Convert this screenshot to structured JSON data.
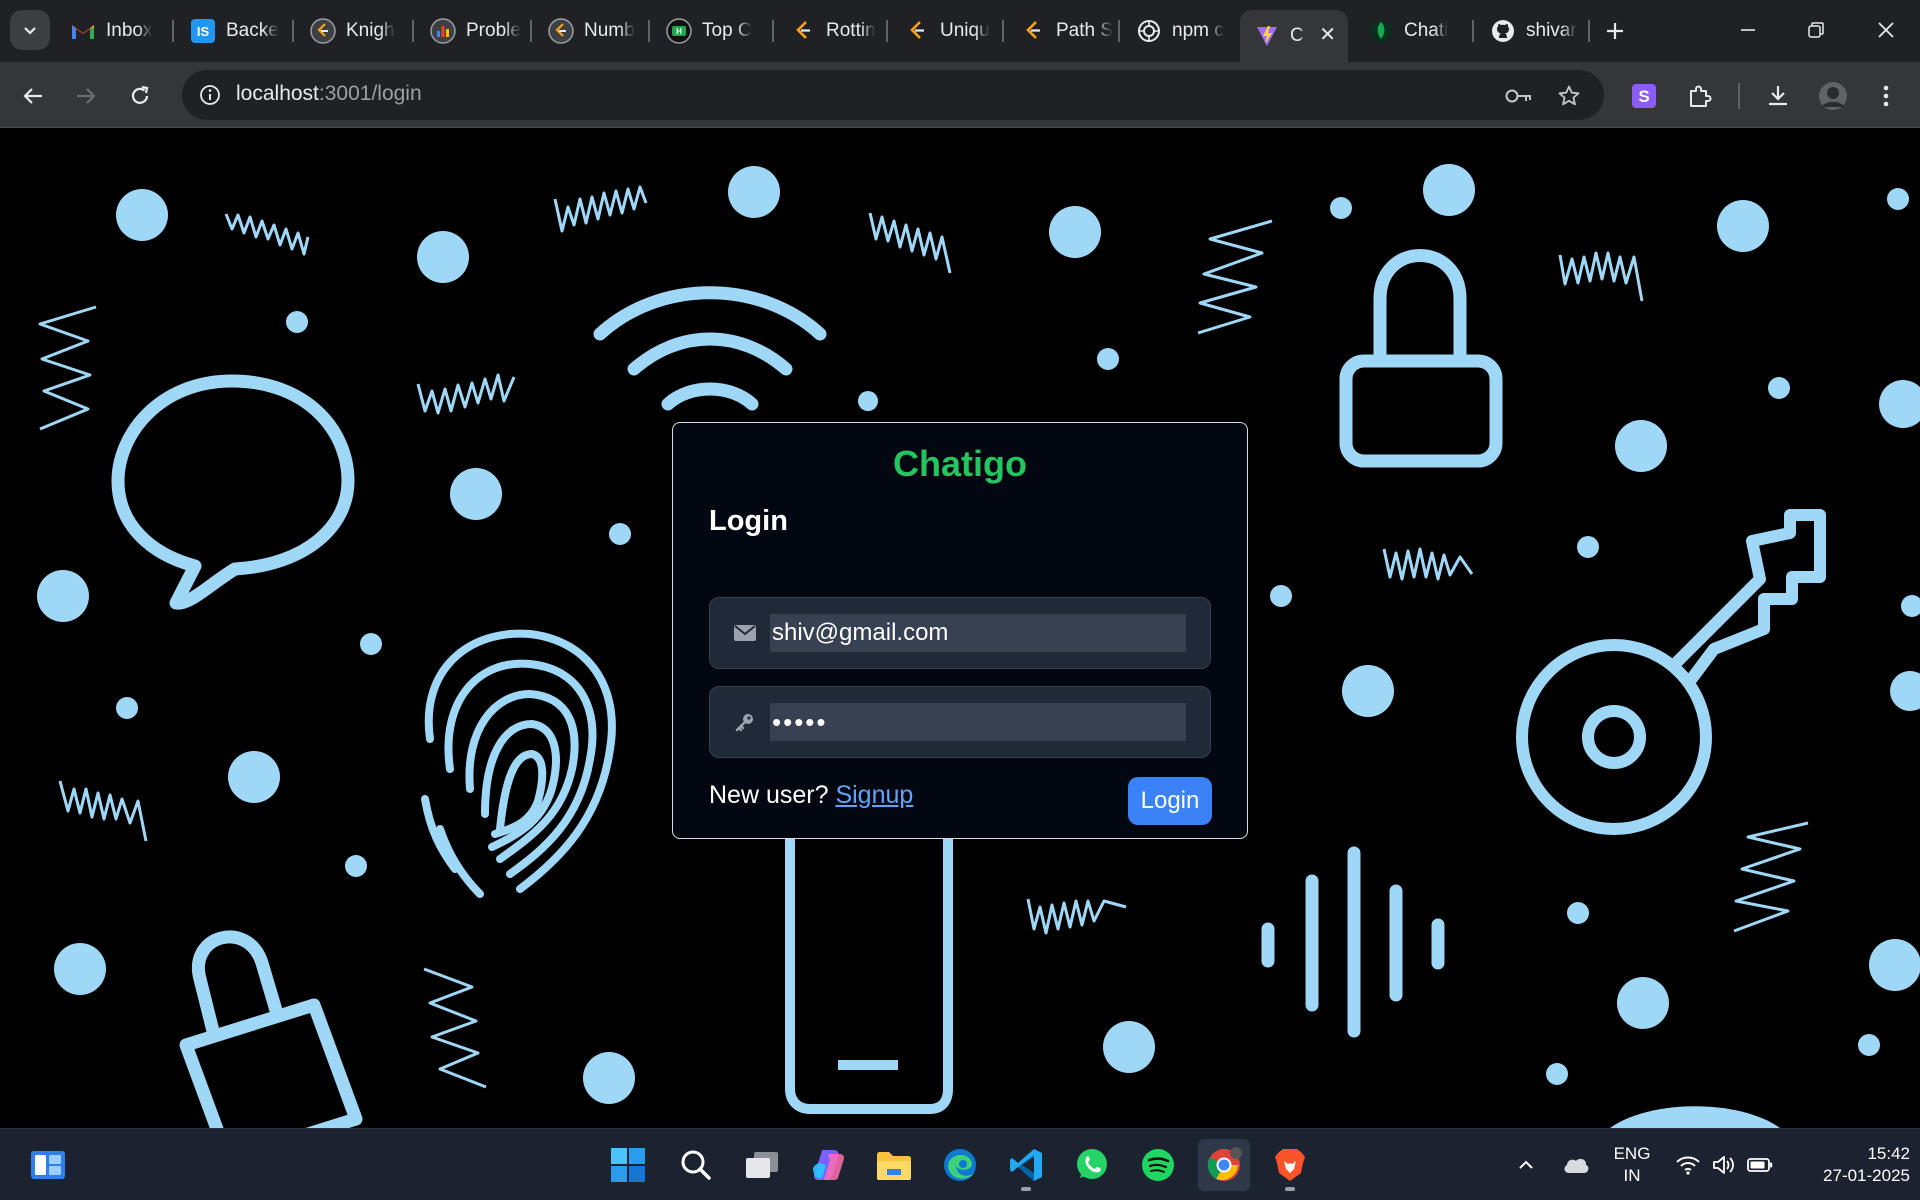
{
  "browser": {
    "tabs": [
      {
        "title": "Inbox",
        "icon": "gmail-icon"
      },
      {
        "title": "Backe",
        "icon": "interviewbit-icon"
      },
      {
        "title": "Knigh",
        "icon": "leetcode-icon"
      },
      {
        "title": "Proble",
        "icon": "leetcode-chart-icon"
      },
      {
        "title": "Numb",
        "icon": "leetcode-icon"
      },
      {
        "title": "Top C",
        "icon": "hackerrank-icon"
      },
      {
        "title": "Rottin",
        "icon": "leetcode-icon"
      },
      {
        "title": "Uniqu",
        "icon": "leetcode-icon"
      },
      {
        "title": "Path S",
        "icon": "leetcode-icon"
      },
      {
        "title": "npm c",
        "icon": "chatgpt-icon"
      },
      {
        "title": "C",
        "icon": "vite-icon",
        "active": true
      },
      {
        "title": "Chati",
        "icon": "mongodb-leaf-icon"
      },
      {
        "title": "shivar",
        "icon": "github-icon"
      }
    ],
    "address": {
      "host": "localhost",
      "path": ":3001/login"
    }
  },
  "page": {
    "brand": "Chatigo",
    "title": "Login",
    "email_value": "shiv@gmail.com",
    "password_value": "•••••",
    "new_user_text": "New user?",
    "signup_link": "Signup",
    "login_button": "Login"
  },
  "colors": {
    "brand": "#22c55e",
    "primary_button": "#3b82f6",
    "link": "#60a5fa",
    "background_doodles": "#9fd8f7"
  },
  "taskbar": {
    "apps": [
      "widgets-icon",
      "windows-start-icon",
      "search-icon",
      "task-view-icon",
      "copilot-icon",
      "file-explorer-icon",
      "edge-icon",
      "vscode-icon",
      "whatsapp-icon",
      "spotify-icon",
      "chrome-icon",
      "brave-icon"
    ],
    "language": [
      "ENG",
      "IN"
    ],
    "time": "15:42",
    "date": "27-01-2025"
  }
}
